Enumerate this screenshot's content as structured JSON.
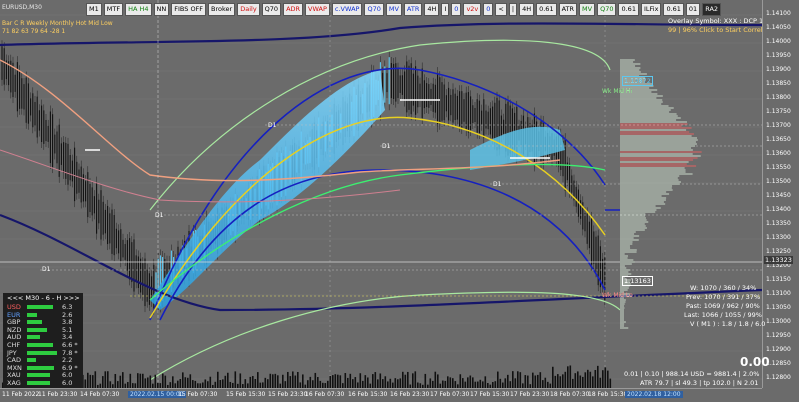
{
  "chart_title": "EURUSD,M30",
  "toolbar": [
    "M1",
    "MTF",
    "HA H4",
    "NN",
    "FIBS OFF",
    "Broker",
    "Daily",
    "Q70",
    "ADR",
    "VWAP",
    "c.VWAP",
    "Q70",
    "MV",
    "ATR",
    "4H",
    "I",
    "0",
    "v2v",
    "0",
    "<",
    "|",
    "4H",
    "0.61",
    "ATR",
    "MV",
    "Q70",
    "0.61",
    "ILFix",
    "0.61",
    "01",
    "RA2"
  ],
  "header_stats": {
    "row1": [
      "Bar",
      "C",
      "R",
      "Weekly",
      "Monthly",
      "Hot",
      "Mid",
      "Low"
    ],
    "row2": [
      "71",
      "82",
      "63",
      "79",
      "64",
      "-28",
      "1"
    ]
  },
  "overlay": {
    "symbol_text": "Overlay Symbol: XXX : DCP 12",
    "correlation_text": "99 | 96% Click to Start Correlation"
  },
  "price_axis": [
    "1.14100",
    "1.14050",
    "1.14000",
    "1.13950",
    "1.13900",
    "1.13850",
    "1.13800",
    "1.13750",
    "1.13700",
    "1.13650",
    "1.13600",
    "1.13550",
    "1.13500",
    "1.13450",
    "1.13400",
    "1.13350",
    "1.13300",
    "1.13250",
    "1.13200",
    "1.13150",
    "1.13100",
    "1.13050",
    "1.13000",
    "1.12950",
    "1.12900",
    "1.12850",
    "1.12800"
  ],
  "price_markers": {
    "current": "1.13323",
    "box1": "1.13872",
    "box2": "1.13163"
  },
  "time_axis": [
    "11 Feb 2022",
    "11 Feb 23:30",
    "14 Feb 07:30",
    "2022.02.15 00:00",
    "15 Feb 07:30",
    "15 Feb 15:30",
    "15 Feb 23:30",
    "16 Feb 07:30",
    "16 Feb 15:30",
    "16 Feb 23:30",
    "17 Feb 07:30",
    "17 Feb 15:30",
    "17 Feb 23:30",
    "18 Feb 07:30",
    "18 Feb 15:30",
    "2022.02.18 12:00"
  ],
  "level_labels": [
    "D1",
    "D1",
    "D1",
    "D1",
    "D1",
    "Wk Mid Hi",
    "Wk Mid Lo"
  ],
  "currency_panel": {
    "header": "<<<  M30 - 6 - H  >>>",
    "rows": [
      {
        "code": "USD",
        "value": "6.3",
        "color": "#2ecc40"
      },
      {
        "code": "EUR",
        "value": "2.6",
        "color": "#2ecc40"
      },
      {
        "code": "GBP",
        "value": "3.8",
        "color": "#2ecc40"
      },
      {
        "code": "NZD",
        "value": "5.1",
        "color": "#2ecc40"
      },
      {
        "code": "AUD",
        "value": "3.4",
        "color": "#2ecc40"
      },
      {
        "code": "CHF",
        "value": "6.6 *",
        "color": "#2ecc40"
      },
      {
        "code": "JPY",
        "value": "7.8 *",
        "color": "#2ecc40"
      },
      {
        "code": "CAD",
        "value": "2.2",
        "color": "#2ecc40"
      },
      {
        "code": "MXN",
        "value": "6.9 *",
        "color": "#2ecc40"
      },
      {
        "code": "XAU",
        "value": "6.0",
        "color": "#2ecc40"
      },
      {
        "code": "XAG",
        "value": "6.0",
        "color": "#2ecc40"
      }
    ]
  },
  "range_stats": {
    "w": "W: 1070 / 360 / 34%",
    "prev": "Prev: 1070 / 391 / 37%",
    "past": "Past: 1069 / 962 / 90%",
    "last": "Last: 1066 / 1055 / 99%",
    "v": "V ( M1 ) : 1.8 / 1.8 / 6.0"
  },
  "account": {
    "balance": "0.00",
    "line1": "0.01  |  0.10  |  988.14 USD = 9881.4  |  2.0%",
    "line2": "ATR 79.7  |  sl 49.3  |  tp 102.0  |  N 2.01"
  },
  "colors": {
    "bg": "#6b6b6b",
    "panel": "#1e1e1e",
    "accent_cyan": "#5cc8f0",
    "yellow": "#e8d020",
    "blue": "#1520c0"
  }
}
